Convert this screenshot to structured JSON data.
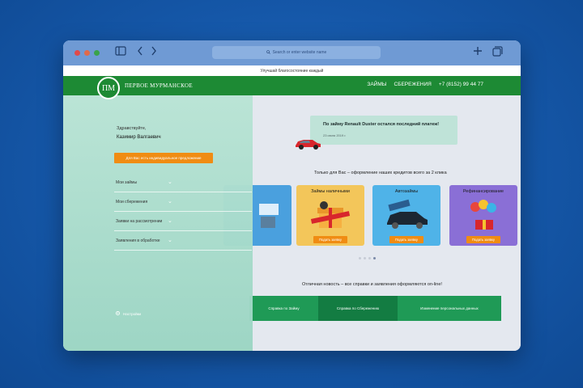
{
  "browser": {
    "address_placeholder": "Search or enter website name",
    "search_icon": "magnifier-icon"
  },
  "top_notice": "Улучшай благосостояние каждый",
  "header": {
    "logo_monogram": "ПМ",
    "logo_text": "ПЕРВОЕ МУРМАНСКОЕ",
    "nav": [
      "ЗАЙМЫ",
      "СБЕРЕЖЕНИЯ",
      "+7 (8152) 99 44 77"
    ]
  },
  "sidebar": {
    "greeting": "Здравствуйте,",
    "user_name": "Казимир Валгаевич",
    "offer_button": "Для Вас есть индивидуальное предложение",
    "menu": [
      {
        "label": "Мои займы"
      },
      {
        "label": "Мои сбережения"
      },
      {
        "label": "Заявки на рассмотрении"
      },
      {
        "label": "Заявления в обработке"
      }
    ],
    "settings_label": "Настройки"
  },
  "main": {
    "notification": {
      "title": "По займу Renault Duster остался последний платеж!",
      "date": "23 июля 2019 г."
    },
    "promo_text": "Только для Вас – оформление наших кредитов всего за 2 клика",
    "cards": [
      {
        "title": "",
        "button": "",
        "color": "#4aa0de"
      },
      {
        "title": "Займы наличными",
        "button": "Подать заявку",
        "color": "#f3c65a"
      },
      {
        "title": "Автозаймы",
        "button": "Подать заявку",
        "color": "#4fb3e8"
      },
      {
        "title": "Рефинансирование",
        "button": "Подать заявку",
        "color": "#8a6fd6"
      }
    ],
    "news": "Отличная новость – все справки и заявления оформляются on-line!",
    "doc_links": [
      "Справка по Займу",
      "Справка по Сбережению",
      "Изменение персональных данных"
    ]
  },
  "colors": {
    "brand_green": "#1d8a34",
    "accent_orange": "#f08c13",
    "background_blue": "#1557a8"
  }
}
